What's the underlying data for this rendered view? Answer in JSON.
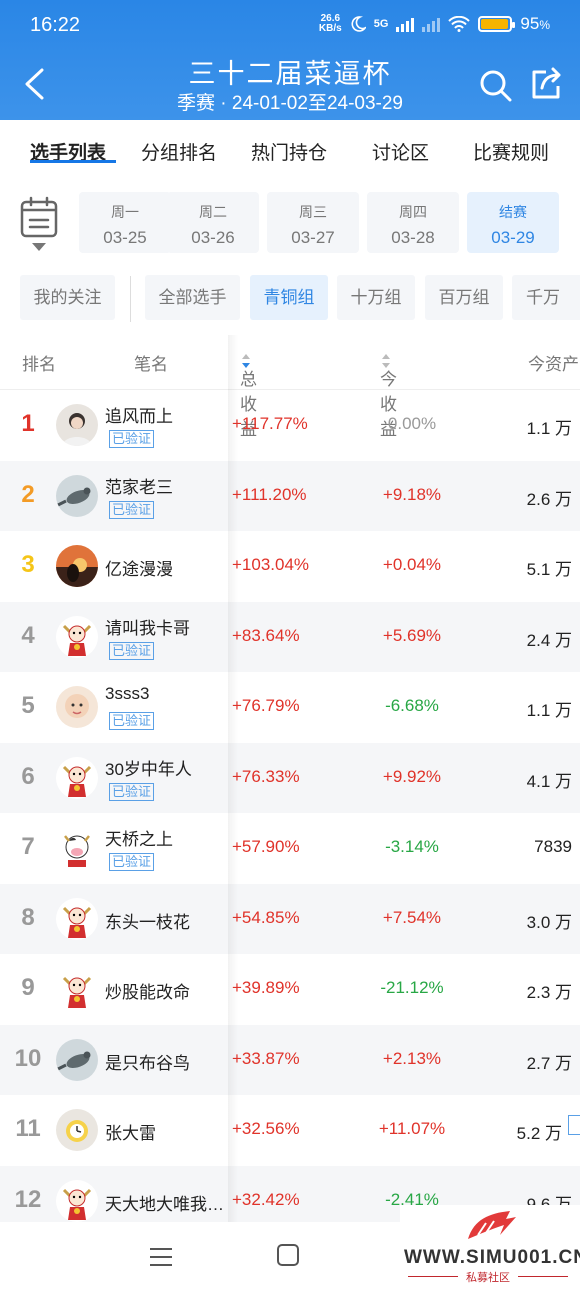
{
  "status": {
    "time": "16:22",
    "netspeed_value": "26.6",
    "netspeed_unit": "KB/s",
    "signal": "5G",
    "battery": "95",
    "battery_unit": "%",
    "battery_level": 0.95
  },
  "header": {
    "title": "三十二届菜逼杯",
    "subtitle": "季赛 · 24-01-02至24-03-29"
  },
  "tabs": [
    "选手列表",
    "分组排名",
    "热门持仓",
    "讨论区",
    "比赛规则"
  ],
  "days": [
    {
      "weekday": "周一",
      "date": "03-25"
    },
    {
      "weekday": "周二",
      "date": "03-26"
    },
    {
      "weekday": "周三",
      "date": "03-27"
    },
    {
      "weekday": "周四",
      "date": "03-28"
    },
    {
      "weekday": "结赛",
      "date": "03-29"
    }
  ],
  "filters": {
    "follow": "我的关注",
    "groups": [
      "全部选手",
      "青铜组",
      "十万组",
      "百万组",
      "千万"
    ]
  },
  "columns": {
    "rank": "排名",
    "name": "笔名",
    "total": "总收益",
    "today": "今收益",
    "assets": "今资产"
  },
  "verified_label": "已验证",
  "rows": [
    {
      "rank": "1",
      "name": "追风而上",
      "verified": true,
      "total": "+117.77%",
      "today": "0.00%",
      "trend": "zero",
      "assets": "1.1 万",
      "avatar": "person-photo"
    },
    {
      "rank": "2",
      "name": "范家老三",
      "verified": true,
      "total": "+111.20%",
      "today": "+9.18%",
      "trend": "pos",
      "assets": "2.6 万",
      "avatar": "bird-photo"
    },
    {
      "rank": "3",
      "name": "亿途漫漫",
      "verified": false,
      "total": "+103.04%",
      "today": "+0.04%",
      "trend": "pos",
      "assets": "5.1 万",
      "avatar": "sunset-photo"
    },
    {
      "rank": "4",
      "name": "请叫我卡哥",
      "verified": true,
      "total": "+83.64%",
      "today": "+5.69%",
      "trend": "pos",
      "assets": "2.4 万",
      "avatar": "bull-mascot"
    },
    {
      "rank": "5",
      "name": "3sss3",
      "verified": true,
      "total": "+76.79%",
      "today": "-6.68%",
      "trend": "neg",
      "assets": "1.1 万",
      "avatar": "baby-photo"
    },
    {
      "rank": "6",
      "name": "30岁中年人",
      "verified": true,
      "total": "+76.33%",
      "today": "+9.92%",
      "trend": "pos",
      "assets": "4.1 万",
      "avatar": "bull-mascot"
    },
    {
      "rank": "7",
      "name": "天桥之上",
      "verified": true,
      "total": "+57.90%",
      "today": "-3.14%",
      "trend": "neg",
      "assets": "7839",
      "avatar": "cow-mascot"
    },
    {
      "rank": "8",
      "name": "东头一枝花",
      "verified": false,
      "total": "+54.85%",
      "today": "+7.54%",
      "trend": "pos",
      "assets": "3.0 万",
      "avatar": "bull-mascot"
    },
    {
      "rank": "9",
      "name": "炒股能改命",
      "verified": false,
      "total": "+39.89%",
      "today": "-21.12%",
      "trend": "neg",
      "assets": "2.3 万",
      "avatar": "bull-mascot"
    },
    {
      "rank": "10",
      "name": "是只布谷鸟",
      "verified": false,
      "total": "+33.87%",
      "today": "+2.13%",
      "trend": "pos",
      "assets": "2.7 万",
      "avatar": "bird-photo"
    },
    {
      "rank": "11",
      "name": "张大雷",
      "verified": false,
      "total": "+32.56%",
      "today": "+11.07%",
      "trend": "pos",
      "assets": "5.2 万",
      "avatar": "clock-photo"
    },
    {
      "rank": "12",
      "name": "天大地大唯我…",
      "verified": false,
      "total": "+32.42%",
      "today": "-2.41%",
      "trend": "neg",
      "assets": "9.6 万",
      "avatar": "bull-mascot"
    }
  ],
  "watermark": {
    "site": "WWW.SIMU001.CN",
    "tagline": "私募社区"
  },
  "colors": {
    "brand": "#2a86e6",
    "up": "#e0332a",
    "down": "#28a745",
    "accent": "#2f86e3"
  }
}
